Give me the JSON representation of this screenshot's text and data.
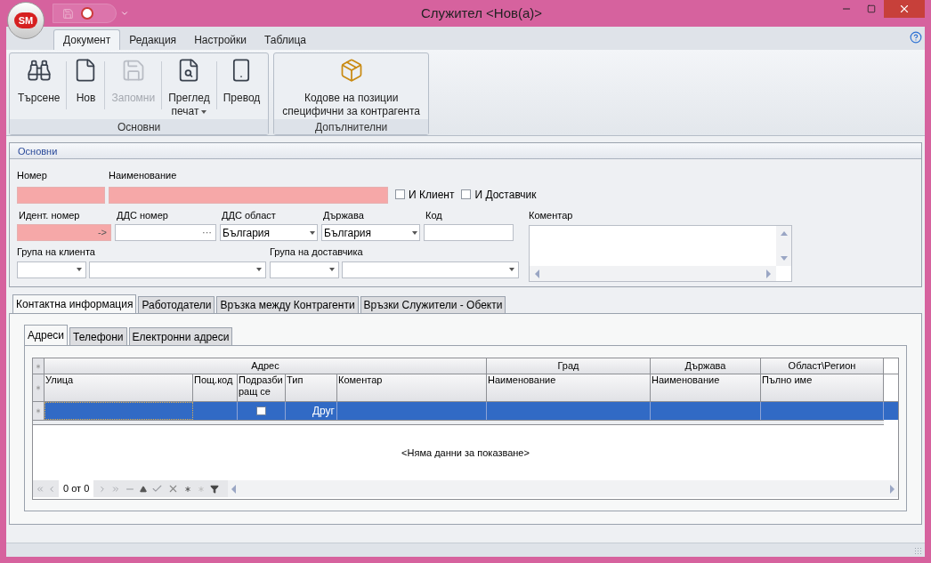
{
  "window": {
    "title": "Служител <Нов(а)>",
    "logo_text": "SM"
  },
  "ribbon": {
    "tabs": [
      {
        "label": "Документ",
        "selected": true
      },
      {
        "label": "Редакция",
        "selected": false
      },
      {
        "label": "Настройки",
        "selected": false
      },
      {
        "label": "Таблица",
        "selected": false
      }
    ],
    "groups": [
      {
        "title": "Основни",
        "buttons": [
          {
            "label": "Търсене",
            "disabled": false
          },
          {
            "label": "Нов",
            "disabled": false
          },
          {
            "label": "Запомни",
            "disabled": true
          },
          {
            "label": "Преглед",
            "label2": "печат",
            "disabled": false,
            "dropdown": true
          },
          {
            "label": "Превод",
            "disabled": false
          }
        ]
      },
      {
        "title": "Допълнителни",
        "buttons": [
          {
            "label": "Кодове на позиции",
            "label2": "специфични за контрагента",
            "disabled": false
          }
        ]
      }
    ]
  },
  "section": {
    "title": "Основни",
    "row1": [
      {
        "label": "Номер",
        "kind": "text",
        "required": true
      },
      {
        "label": "Наименование",
        "kind": "text",
        "required": true
      }
    ],
    "checkboxes": [
      {
        "label": "И Клиент",
        "checked": false
      },
      {
        "label": "И Доставчик",
        "checked": false
      }
    ],
    "row2": [
      {
        "label": "Идент. номер",
        "kind": "button_edit",
        "required": true,
        "button": "->"
      },
      {
        "label": "ДДС номер",
        "kind": "button_edit",
        "required": false,
        "button": "···"
      },
      {
        "label": "ДДС област",
        "kind": "combo",
        "value": "България"
      },
      {
        "label": "Държава",
        "kind": "combo",
        "value": "България"
      },
      {
        "label": "Код",
        "kind": "text",
        "required": false
      }
    ],
    "row3": [
      {
        "label": "Група на клиента",
        "kind": "combo_pair"
      },
      {
        "label": "Група на доставчика",
        "kind": "combo_pair"
      }
    ],
    "comment": {
      "label": "Коментар"
    }
  },
  "tabs": [
    {
      "label": "Контактна информация",
      "selected": true
    },
    {
      "label": "Работодатели",
      "selected": false
    },
    {
      "label": "Връзка между Контрагенти",
      "selected": false
    },
    {
      "label": "Връзки Служители - Обекти",
      "selected": false
    }
  ],
  "subtabs": [
    {
      "label": "Адреси",
      "selected": true
    },
    {
      "label": "Телефони",
      "selected": false
    },
    {
      "label": "Електронни адреси",
      "selected": false
    }
  ],
  "grid": {
    "bands": [
      {
        "label": "Адрес",
        "columns": [
          "Улица",
          "Пощ.код",
          "Подразбиращ се",
          "Тип",
          "Коментар"
        ]
      },
      {
        "label": "Град",
        "columns": [
          "Наименование"
        ]
      },
      {
        "label": "Държава",
        "columns": [
          "Наименование"
        ]
      },
      {
        "label": "Област\\Регион",
        "columns": [
          "Пълно име"
        ]
      }
    ],
    "new_row": {
      "selected": true,
      "default_checked": false,
      "type": "Друг"
    },
    "empty_text": "<Няма данни за показване>",
    "navigator": "0 от 0"
  }
}
